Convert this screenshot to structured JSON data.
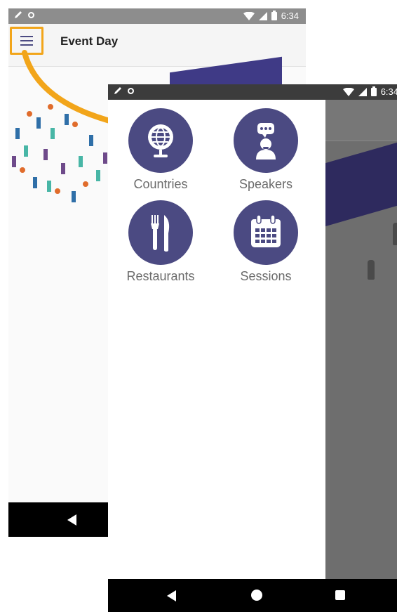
{
  "back_screen": {
    "status_bar": {
      "time": "6:34",
      "icons": [
        "pencil-icon",
        "circle-icon",
        "wifi-icon",
        "signal-icon",
        "battery-icon"
      ]
    },
    "app_bar": {
      "title": "Event Day",
      "menu_icon": "hamburger-icon"
    },
    "highlight_color": "#f2a51a"
  },
  "front_screen": {
    "status_bar": {
      "time": "6:34",
      "icons": [
        "pencil-icon",
        "circle-icon",
        "wifi-icon",
        "signal-icon",
        "battery-icon"
      ]
    },
    "drawer": {
      "items": [
        {
          "label": "Countries",
          "icon": "globe-icon"
        },
        {
          "label": "Speakers",
          "icon": "speaker-icon"
        },
        {
          "label": "Restaurants",
          "icon": "cutlery-icon"
        },
        {
          "label": "Sessions",
          "icon": "calendar-icon"
        }
      ],
      "icon_bg_color": "#4b4a82"
    },
    "nav_bar": {
      "buttons": [
        "back-icon",
        "home-icon",
        "recents-icon"
      ]
    }
  }
}
